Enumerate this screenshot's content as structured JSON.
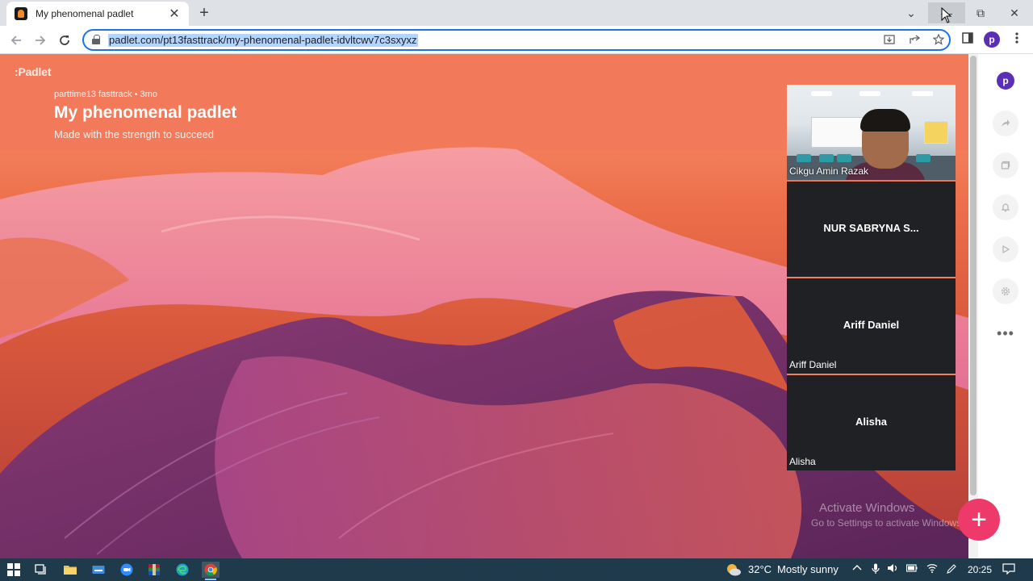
{
  "browser": {
    "tab_title": "My phenomenal padlet",
    "tab_close": "✕",
    "new_tab": "+",
    "url": "padlet.com/pt13fasttrack/my-phenomenal-padlet-idvltcwv7c3sxyxz",
    "profile_initial": "p",
    "window_controls": {
      "chevron": "⌄",
      "minimize": "—",
      "restore": "⧉",
      "close": "✕"
    },
    "icons": [
      "back-icon",
      "forward-icon",
      "reload-icon",
      "lock-icon",
      "install-icon",
      "share-icon",
      "star-icon",
      "side-panel-icon",
      "menu-icon"
    ]
  },
  "padlet": {
    "logo": ":Padlet",
    "meta": "parttime13 fasttrack  •  3mo",
    "title": "My phenomenal padlet",
    "description": "Made with the strength to succeed",
    "profile_initial": "p",
    "add_button": "+",
    "rail_more": "•••"
  },
  "meet": {
    "participants": [
      {
        "corner_label": "Cikgu Amin Razak",
        "center_name": "",
        "video": true
      },
      {
        "corner_label": "",
        "center_name": "NUR SABRYNA S...",
        "video": false
      },
      {
        "corner_label": "Ariff Daniel",
        "center_name": "Ariff Daniel",
        "video": false
      },
      {
        "corner_label": "Alisha",
        "center_name": "Alisha",
        "video": false
      }
    ]
  },
  "watermark": {
    "line1": "Activate Windows",
    "line2": "Go to Settings to activate Windows."
  },
  "taskbar": {
    "temperature": "32°C",
    "weather": "Mostly sunny",
    "time": "20:25",
    "apps": [
      "start-icon",
      "task-view-icon",
      "file-explorer-icon",
      "keyboard-icon",
      "zoom-icon",
      "winrar-icon",
      "edge-icon",
      "chrome-icon"
    ]
  },
  "colors": {
    "accent": "#1a73e8",
    "fab": "#ee3a6b",
    "profile": "#5b2fb5",
    "taskbar": "#1f3a4b",
    "tile": "#202124"
  }
}
